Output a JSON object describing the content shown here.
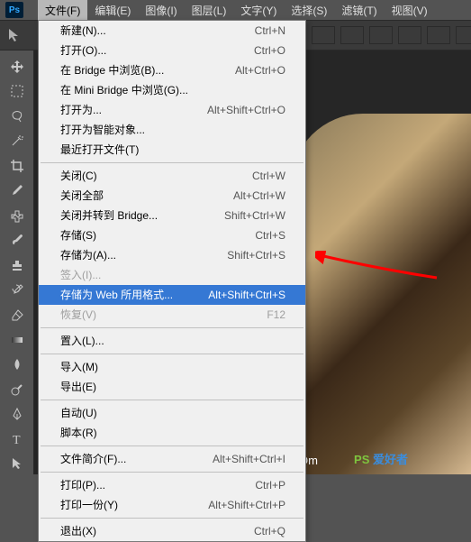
{
  "app": {
    "logo": "Ps"
  },
  "menubar": {
    "items": [
      {
        "label": "文件(F)"
      },
      {
        "label": "编辑(E)"
      },
      {
        "label": "图像(I)"
      },
      {
        "label": "图层(L)"
      },
      {
        "label": "文字(Y)"
      },
      {
        "label": "选择(S)"
      },
      {
        "label": "滤镜(T)"
      },
      {
        "label": "视图(V)"
      }
    ]
  },
  "dropdown": {
    "groups": [
      [
        {
          "label": "新建(N)...",
          "shortcut": "Ctrl+N",
          "disabled": false
        },
        {
          "label": "打开(O)...",
          "shortcut": "Ctrl+O",
          "disabled": false
        },
        {
          "label": "在 Bridge 中浏览(B)...",
          "shortcut": "Alt+Ctrl+O",
          "disabled": false
        },
        {
          "label": "在 Mini Bridge 中浏览(G)...",
          "shortcut": "",
          "disabled": false
        },
        {
          "label": "打开为...",
          "shortcut": "Alt+Shift+Ctrl+O",
          "disabled": false
        },
        {
          "label": "打开为智能对象...",
          "shortcut": "",
          "disabled": false
        },
        {
          "label": "最近打开文件(T)",
          "shortcut": "",
          "disabled": false
        }
      ],
      [
        {
          "label": "关闭(C)",
          "shortcut": "Ctrl+W",
          "disabled": false
        },
        {
          "label": "关闭全部",
          "shortcut": "Alt+Ctrl+W",
          "disabled": false
        },
        {
          "label": "关闭并转到 Bridge...",
          "shortcut": "Shift+Ctrl+W",
          "disabled": false
        },
        {
          "label": "存储(S)",
          "shortcut": "Ctrl+S",
          "disabled": false
        },
        {
          "label": "存储为(A)...",
          "shortcut": "Shift+Ctrl+S",
          "disabled": false
        },
        {
          "label": "签入(I)...",
          "shortcut": "",
          "disabled": true
        },
        {
          "label": "存储为 Web 所用格式...",
          "shortcut": "Alt+Shift+Ctrl+S",
          "disabled": false,
          "highlighted": true
        },
        {
          "label": "恢复(V)",
          "shortcut": "F12",
          "disabled": true
        }
      ],
      [
        {
          "label": "置入(L)...",
          "shortcut": "",
          "disabled": false
        }
      ],
      [
        {
          "label": "导入(M)",
          "shortcut": "",
          "disabled": false
        },
        {
          "label": "导出(E)",
          "shortcut": "",
          "disabled": false
        }
      ],
      [
        {
          "label": "自动(U)",
          "shortcut": "",
          "disabled": false
        },
        {
          "label": "脚本(R)",
          "shortcut": "",
          "disabled": false
        }
      ],
      [
        {
          "label": "文件简介(F)...",
          "shortcut": "Alt+Shift+Ctrl+I",
          "disabled": false
        }
      ],
      [
        {
          "label": "打印(P)...",
          "shortcut": "Ctrl+P",
          "disabled": false
        },
        {
          "label": "打印一份(Y)",
          "shortcut": "Alt+Shift+Ctrl+P",
          "disabled": false
        }
      ],
      [
        {
          "label": "退出(X)",
          "shortcut": "Ctrl+Q",
          "disabled": false
        }
      ]
    ]
  },
  "sidebar_tools": [
    "move",
    "marquee",
    "lasso",
    "wand",
    "crop",
    "eyedropper",
    "heal",
    "brush",
    "stamp",
    "history-brush",
    "eraser",
    "gradient",
    "blur",
    "dodge",
    "pen",
    "type",
    "path-select"
  ],
  "watermark": {
    "ps": "PS",
    "rest": " 爱好者",
    "url": "UiBO.COm"
  }
}
